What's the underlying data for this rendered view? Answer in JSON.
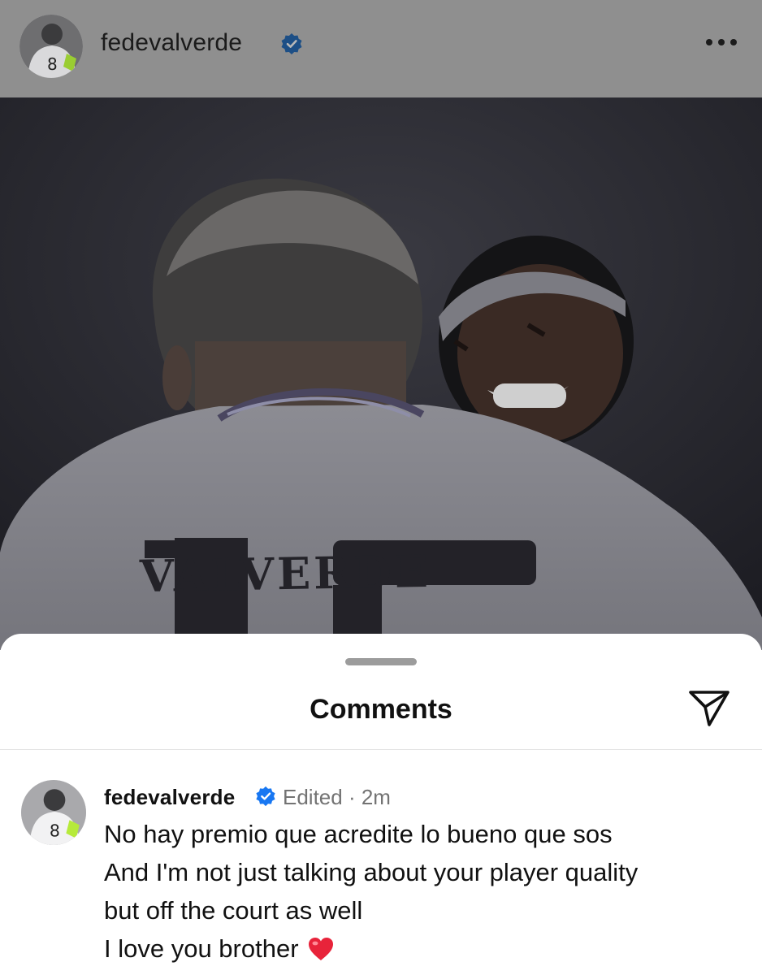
{
  "post": {
    "username": "fedevalverde",
    "jersey_name": "VALVERDE",
    "jersey_number": "15",
    "avatar_number": "8"
  },
  "comments_sheet": {
    "title": "Comments",
    "comment": {
      "username": "fedevalverde",
      "meta": "Edited · 2m",
      "lines": [
        "No hay premio que acredite lo bueno que sos",
        "And I'm not just talking about your player quality",
        "but off the court as well",
        "I love you brother"
      ]
    }
  },
  "colors": {
    "verified_blue": "#1877f2",
    "heart_red": "#e8233a",
    "overlay_gray": "#8f8f8f"
  },
  "icons": [
    "verified-badge-icon",
    "more-options-icon",
    "share-icon",
    "heart-emoji-icon"
  ]
}
